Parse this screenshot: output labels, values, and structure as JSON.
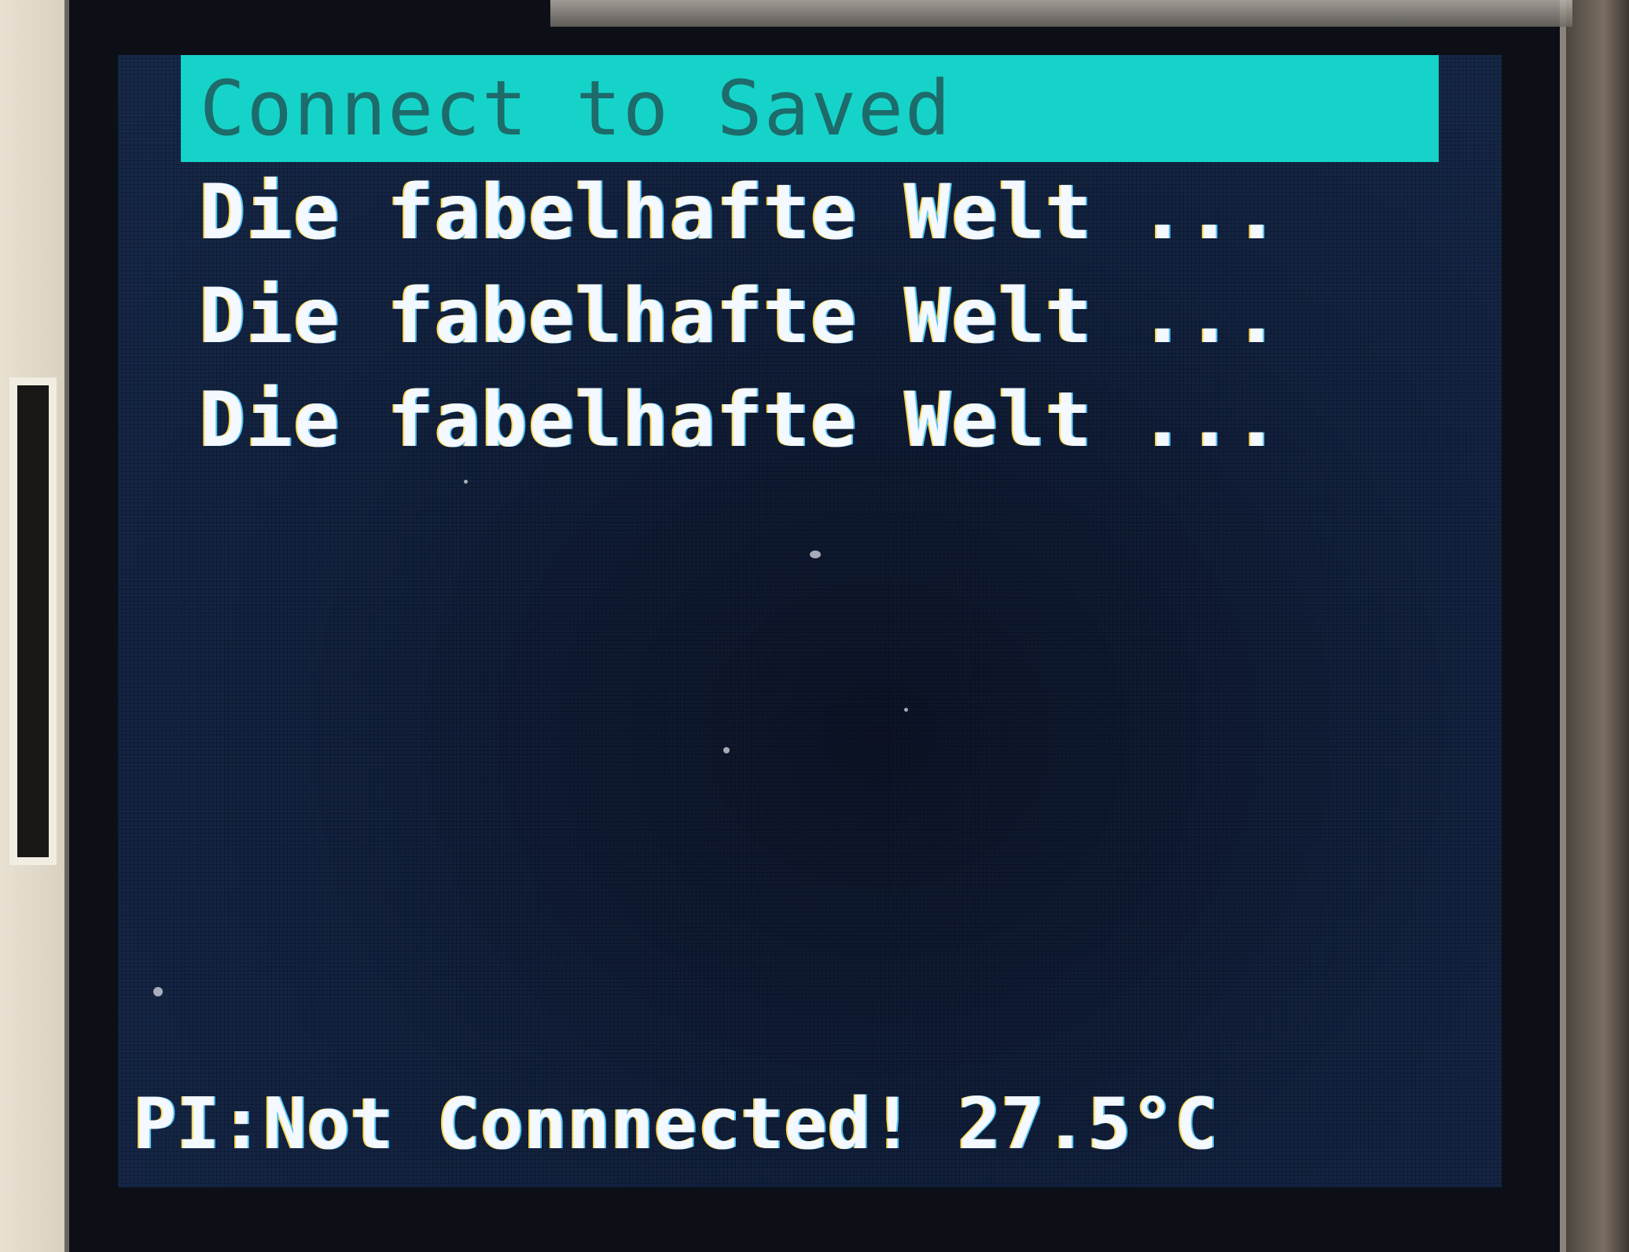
{
  "menu": {
    "items": [
      {
        "label": "Connect to Saved",
        "selected": true
      },
      {
        "label": "Die fabelhafte Welt ...",
        "selected": false
      },
      {
        "label": "Die fabelhafte Welt ...",
        "selected": false
      },
      {
        "label": "Die fabelhafte Welt ...",
        "selected": false
      }
    ]
  },
  "status": {
    "prefix": "PI:",
    "connection": "Not Connnected!",
    "temperature": "27.5°C"
  },
  "colors": {
    "screen_background": "#12223f",
    "selection_highlight": "#15d3c8",
    "selected_text": "#1d6b6a",
    "text": "#f4f8ff"
  }
}
